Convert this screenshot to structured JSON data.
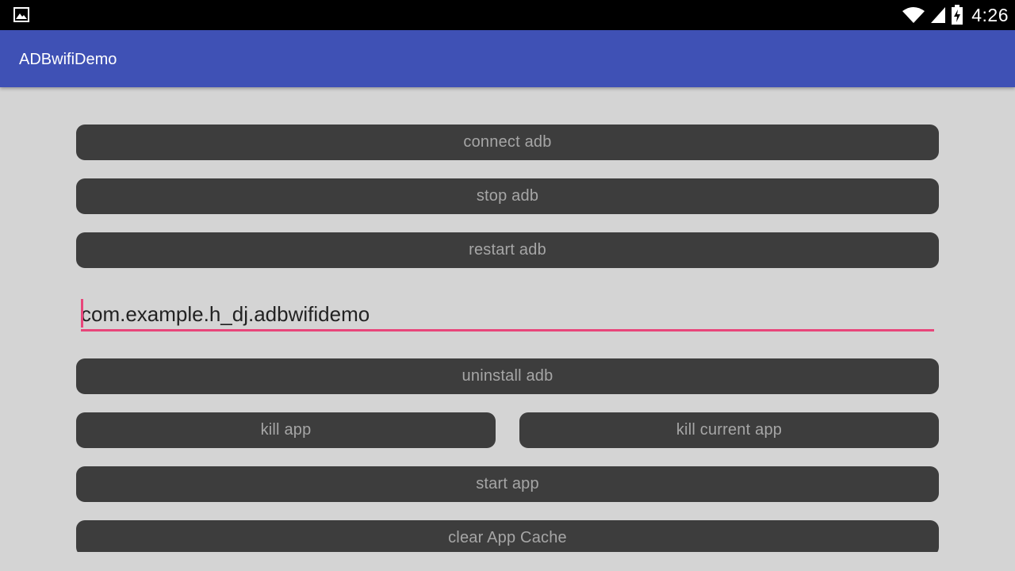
{
  "status_bar": {
    "time": "4:26",
    "left_icon": "image-icon",
    "right_icons": [
      "wifi-icon",
      "signal-icon",
      "battery-charging-icon"
    ]
  },
  "app_bar": {
    "title": "ADBwifiDemo",
    "color": "#3f51b5"
  },
  "buttons": {
    "connect": "connect adb",
    "stop": "stop adb",
    "restart": "restart adb",
    "uninstall": "uninstall adb",
    "kill_app": "kill app",
    "kill_current_app": "kill current app",
    "start_app": "start app",
    "clear_cache": "clear App Cache"
  },
  "package_input": {
    "value": "com.example.h_dj.adbwifidemo"
  },
  "colors": {
    "background": "#d4d4d4",
    "button": "#3d3d3d",
    "button_text": "#a6a6a6",
    "accent": "#e8457a"
  }
}
